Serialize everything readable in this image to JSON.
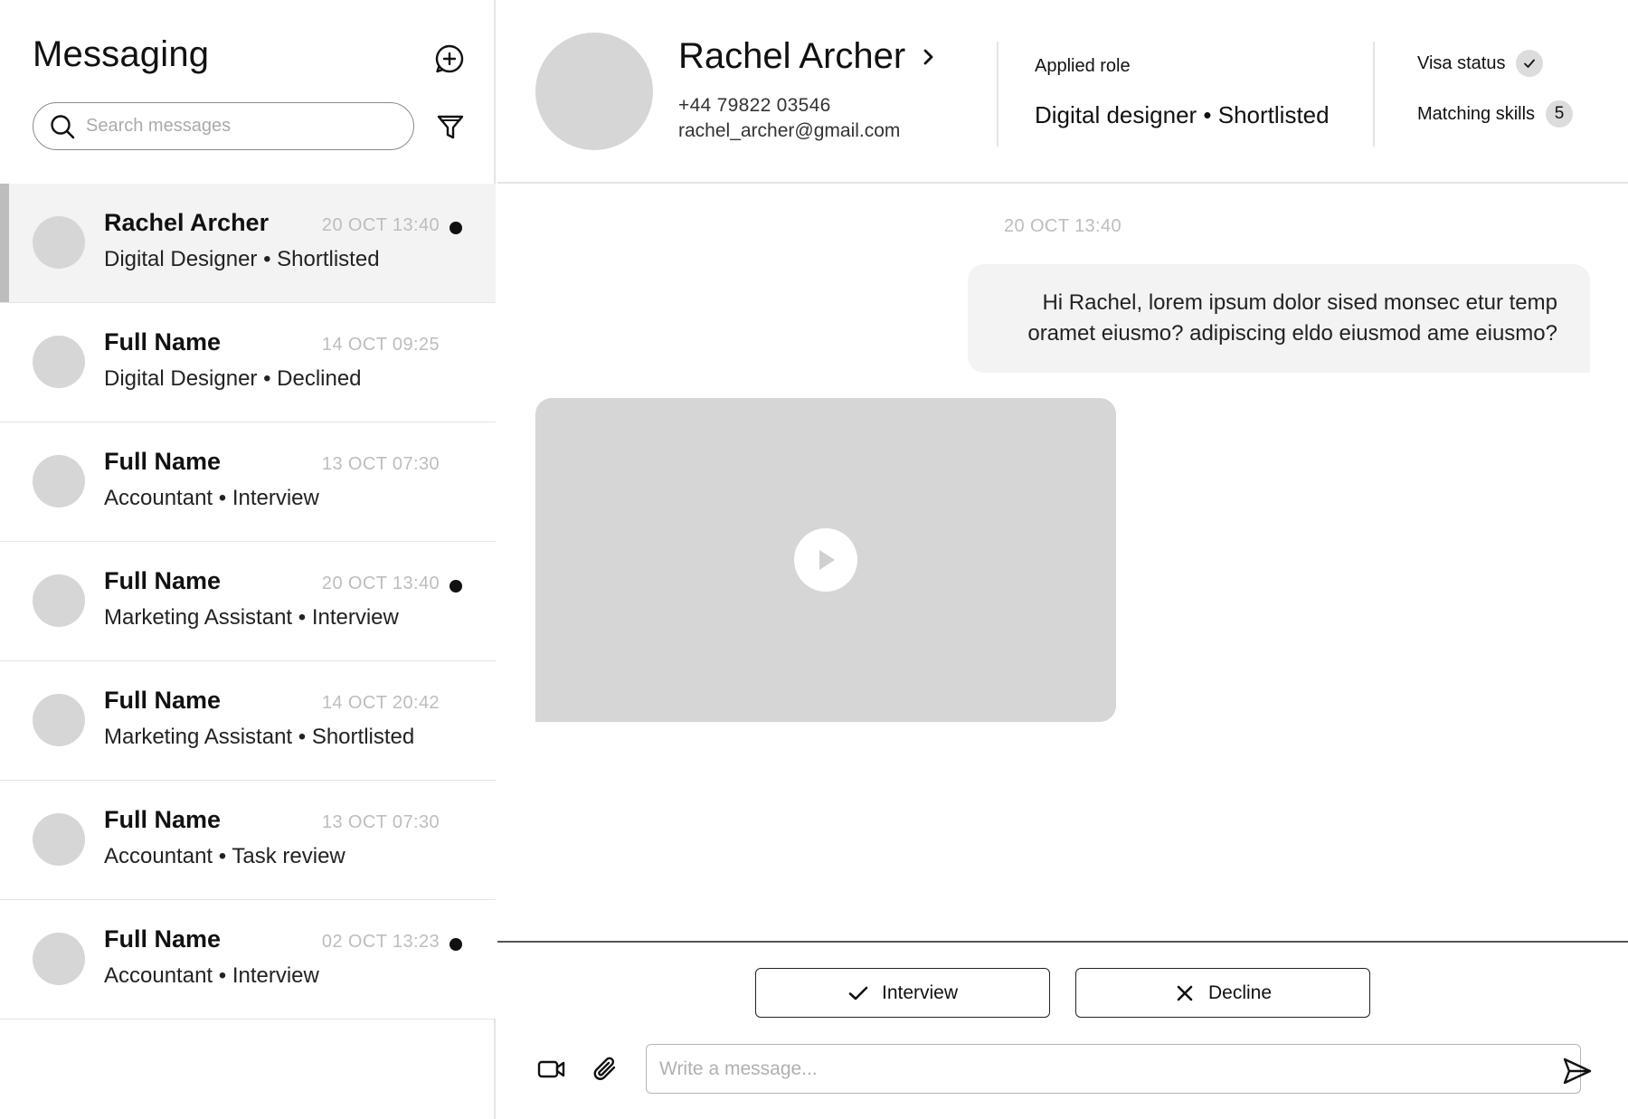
{
  "sidebar": {
    "title": "Messaging",
    "search_placeholder": "Search messages",
    "conversations": [
      {
        "name": "Rachel Archer",
        "time": "20 OCT 13:40",
        "subtitle": "Digital Designer • Shortlisted",
        "unread": true,
        "active": true
      },
      {
        "name": "Full Name",
        "time": "14 OCT 09:25",
        "subtitle": "Digital Designer • Declined",
        "unread": false,
        "active": false
      },
      {
        "name": "Full Name",
        "time": "13 OCT 07:30",
        "subtitle": "Accountant • Interview",
        "unread": false,
        "active": false
      },
      {
        "name": "Full Name",
        "time": "20 OCT 13:40",
        "subtitle": "Marketing Assistant • Interview",
        "unread": true,
        "active": false
      },
      {
        "name": "Full Name",
        "time": "14 OCT 20:42",
        "subtitle": "Marketing Assistant • Shortlisted",
        "unread": false,
        "active": false
      },
      {
        "name": "Full Name",
        "time": "13 OCT 07:30",
        "subtitle": "Accountant • Task review",
        "unread": false,
        "active": false
      },
      {
        "name": "Full Name",
        "time": "02 OCT 13:23",
        "subtitle": "Accountant • Interview",
        "unread": true,
        "active": false
      }
    ]
  },
  "profile": {
    "name": "Rachel Archer",
    "phone": "+44 79822 03546",
    "email": "rachel_archer@gmail.com",
    "applied_role_label": "Applied role",
    "applied_role_value": "Digital designer • Shortlisted",
    "visa_status_label": "Visa status",
    "matching_skills_label": "Matching skills",
    "matching_skills_count": "5"
  },
  "chat": {
    "timestamp": "20 OCT 13:40",
    "outgoing_message": "Hi Rachel, lorem ipsum dolor sised monsec etur temp oramet eiusmo? adipiscing eldo eiusmod ame eiusmo?"
  },
  "composer": {
    "interview_label": "Interview",
    "decline_label": "Decline",
    "message_placeholder": "Write a message..."
  },
  "icons": {
    "new_message": "new-message-icon",
    "search": "search-icon",
    "filter": "filter-icon",
    "chevron": "chevron-right-icon",
    "visa_check": "check-icon",
    "play": "play-icon",
    "interview_check": "check-icon",
    "decline_x": "close-icon",
    "video": "video-camera-icon",
    "attach": "paperclip-icon",
    "send": "send-icon"
  },
  "colors": {
    "unread_dot": "#111111",
    "active_row": "#f3f3f3",
    "placeholder_gray": "#d6d6d6"
  }
}
